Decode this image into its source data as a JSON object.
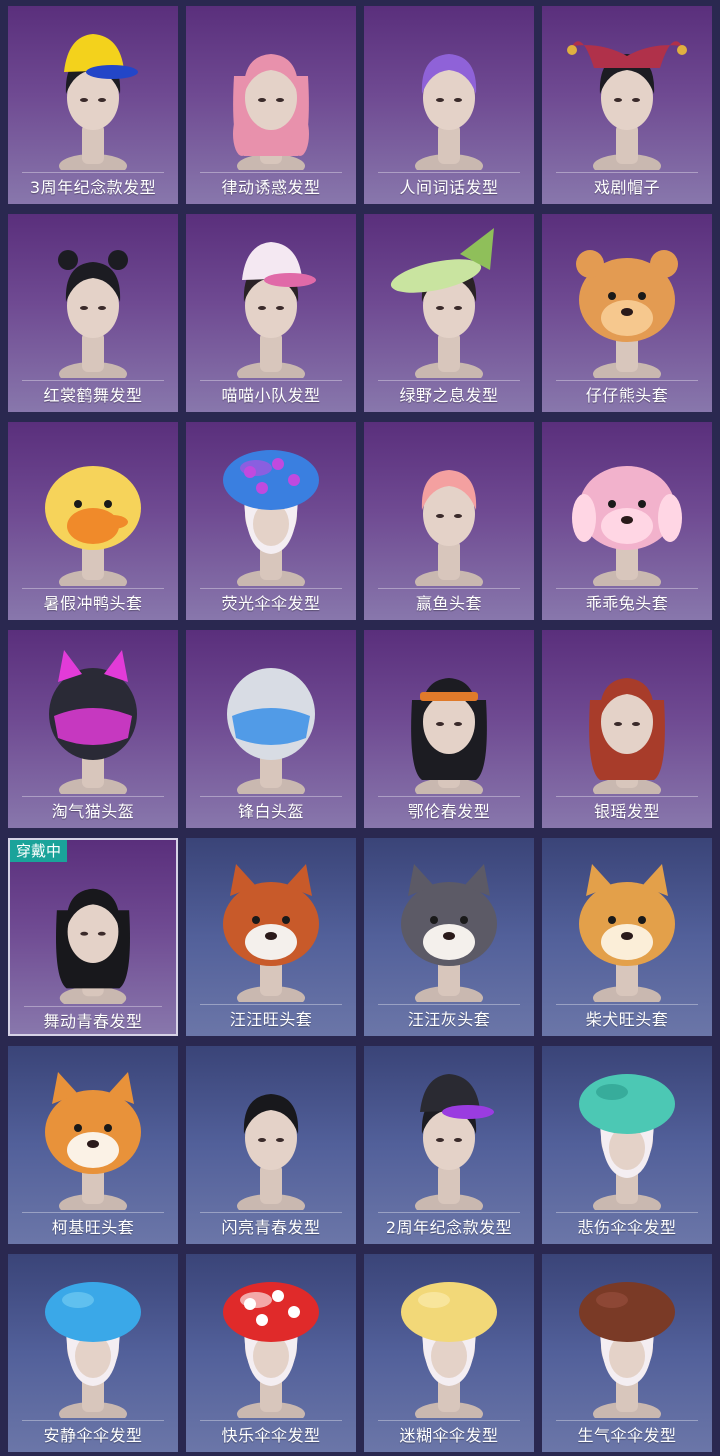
{
  "grid": {
    "items": [
      {
        "label": "3周年纪念款发型",
        "icon": "baseball-cap-hair-icon",
        "bg": "purple",
        "accent": "#f3d21c",
        "accent2": "#2346c8",
        "hair": "#1c1c22"
      },
      {
        "label": "律动诱惑发型",
        "icon": "pink-twin-tail-hair-icon",
        "bg": "purple",
        "accent": "#e891ac",
        "accent2": "#f2b2c4",
        "hair": "#e891ac"
      },
      {
        "label": "人间词话发型",
        "icon": "purple-bob-hair-icon",
        "bg": "purple",
        "accent": "#8f62d8",
        "accent2": "#3050d0",
        "hair": "#8f62d8"
      },
      {
        "label": "戏剧帽子",
        "icon": "jester-hat-icon",
        "bg": "purple",
        "accent": "#b0314a",
        "accent2": "#e0b040",
        "hair": "#1c1c22"
      },
      {
        "label": "红裳鹤舞发型",
        "icon": "space-buns-hair-icon",
        "bg": "purple",
        "accent": "#1c1c22",
        "accent2": "#333",
        "hair": "#1c1c22"
      },
      {
        "label": "喵喵小队发型",
        "icon": "cat-ear-cap-icon",
        "bg": "purple",
        "accent": "#f4e8f2",
        "accent2": "#e06aa8",
        "hair": "#2a2226"
      },
      {
        "label": "绿野之息发型",
        "icon": "butterfly-hat-icon",
        "bg": "purple",
        "accent": "#c9e4a0",
        "accent2": "#8fbf5a",
        "hair": "#2a2226"
      },
      {
        "label": "仔仔熊头套",
        "icon": "bear-head-icon",
        "bg": "purple",
        "accent": "#e39b52",
        "accent2": "#f6c88e",
        "hair": "#e39b52"
      },
      {
        "label": "暑假冲鸭头套",
        "icon": "duck-head-icon",
        "bg": "purple",
        "accent": "#f6d35a",
        "accent2": "#f08a2a",
        "hair": "#f6d35a"
      },
      {
        "label": "荧光伞伞发型",
        "icon": "glow-mushroom-hat-icon",
        "bg": "purple",
        "accent": "#3a7fe0",
        "accent2": "#c04adf",
        "hair": "#3a7fe0"
      },
      {
        "label": "赢鱼头套",
        "icon": "lion-mask-hat-icon",
        "bg": "purple",
        "accent": "#c8402a",
        "accent2": "#f0d8c0",
        "hair": "#f4a0a0"
      },
      {
        "label": "乖乖兔头套",
        "icon": "bunny-head-icon",
        "bg": "purple",
        "accent": "#f2b2cc",
        "accent2": "#ffd6e4",
        "hair": "#f2b2cc"
      },
      {
        "label": "淘气猫头盔",
        "icon": "cat-helmet-icon",
        "bg": "purple",
        "accent": "#2a2a36",
        "accent2": "#e23bd8",
        "hair": "#2a2a36"
      },
      {
        "label": "锋白头盔",
        "icon": "white-helmet-icon",
        "bg": "purple",
        "accent": "#d8dce4",
        "accent2": "#3a8fe8",
        "hair": "#d8dce4"
      },
      {
        "label": "鄂伦春发型",
        "icon": "beaded-headband-hair-icon",
        "bg": "purple",
        "accent": "#e07a2a",
        "accent2": "#3a6ad0",
        "hair": "#1c1c22"
      },
      {
        "label": "银瑶发型",
        "icon": "long-red-hair-icon",
        "bg": "purple",
        "accent": "#b0402c",
        "accent2": "#8a2c22",
        "hair": "#a83c2a"
      },
      {
        "label": "舞动青春发型",
        "icon": "black-long-hair-icon",
        "bg": "purple",
        "accent": "#18181c",
        "accent2": "#2a2a30",
        "hair": "#18181c",
        "badge": "穿戴中"
      },
      {
        "label": "汪汪旺头套",
        "icon": "shiba-red-head-icon",
        "bg": "blue",
        "accent": "#c85a2a",
        "accent2": "#f4f0ec",
        "hair": "#c85a2a"
      },
      {
        "label": "汪汪灰头套",
        "icon": "husky-head-icon",
        "bg": "blue",
        "accent": "#5c5a66",
        "accent2": "#f4f0ec",
        "hair": "#5c5a66"
      },
      {
        "label": "柴犬旺头套",
        "icon": "shiba-head-icon",
        "bg": "blue",
        "accent": "#e3a04a",
        "accent2": "#fbeed8",
        "hair": "#e3a04a"
      },
      {
        "label": "柯基旺头套",
        "icon": "corgi-head-icon",
        "bg": "blue",
        "accent": "#e8923a",
        "accent2": "#fbf2e6",
        "hair": "#e8923a"
      },
      {
        "label": "闪亮青春发型",
        "icon": "black-bob-hair-icon",
        "bg": "blue",
        "accent": "#18181c",
        "accent2": "#2a2a30",
        "hair": "#18181c"
      },
      {
        "label": "2周年纪念款发型",
        "icon": "graffiti-cap-hair-icon",
        "bg": "blue",
        "accent": "#2a2a32",
        "accent2": "#9a3ce0",
        "hair": "#1c1c22"
      },
      {
        "label": "悲伤伞伞发型",
        "icon": "teal-mushroom-hat-icon",
        "bg": "blue",
        "accent": "#4cc8b4",
        "accent2": "#2a9a8a",
        "hair": "#4cc8b4"
      },
      {
        "label": "安静伞伞发型",
        "icon": "blue-mushroom-hat-icon",
        "bg": "blue",
        "accent": "#3aa8e8",
        "accent2": "#7ad0f4",
        "hair": "#3aa8e8"
      },
      {
        "label": "快乐伞伞发型",
        "icon": "red-mushroom-hat-icon",
        "bg": "blue",
        "accent": "#e02a2a",
        "accent2": "#ffffff",
        "hair": "#e02a2a"
      },
      {
        "label": "迷糊伞伞发型",
        "icon": "yellow-mushroom-hat-icon",
        "bg": "blue",
        "accent": "#f2d878",
        "accent2": "#fbeeb4",
        "hair": "#f2d878"
      },
      {
        "label": "生气伞伞发型",
        "icon": "brown-mushroom-hat-icon",
        "bg": "blue",
        "accent": "#7a3a26",
        "accent2": "#9a5040",
        "hair": "#7a3a26"
      }
    ]
  }
}
